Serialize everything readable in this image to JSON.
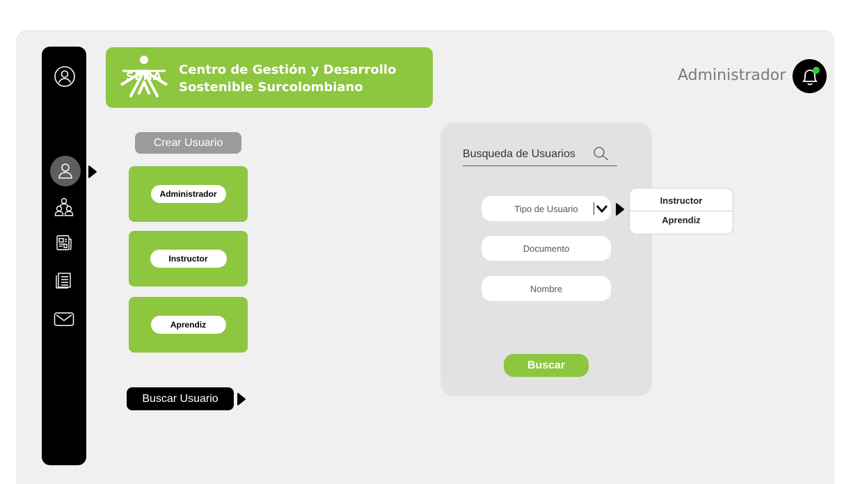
{
  "header": {
    "logo_text": "SENA",
    "title_line1": "Centro de Gestión y Desarrollo",
    "title_line2": "Sostenible Surcolombiano",
    "user_role": "Administrador"
  },
  "sidebar": {
    "items": [
      {
        "icon": "user-circle-icon"
      },
      {
        "icon": "user-icon",
        "active": true
      },
      {
        "icon": "users-group-icon"
      },
      {
        "icon": "news-icon"
      },
      {
        "icon": "document-list-icon"
      },
      {
        "icon": "mail-icon"
      }
    ]
  },
  "actions": {
    "create_user_label": "Crear Usuario",
    "roles": [
      "Administrador",
      "Instructor",
      "Aprendiz"
    ],
    "search_user_label": "Buscar Usuario"
  },
  "search_panel": {
    "title": "Busqueda de Usuarios",
    "user_type_placeholder": "Tipo de Usuario",
    "document_placeholder": "Documento",
    "name_placeholder": "Nombre",
    "submit_label": "Buscar",
    "dropdown_options": [
      "Instructor",
      "Aprendiz"
    ]
  },
  "colors": {
    "brand_green": "#8dc63f",
    "sidebar_bg": "#000000",
    "notification_dot": "#2ecc2e"
  }
}
